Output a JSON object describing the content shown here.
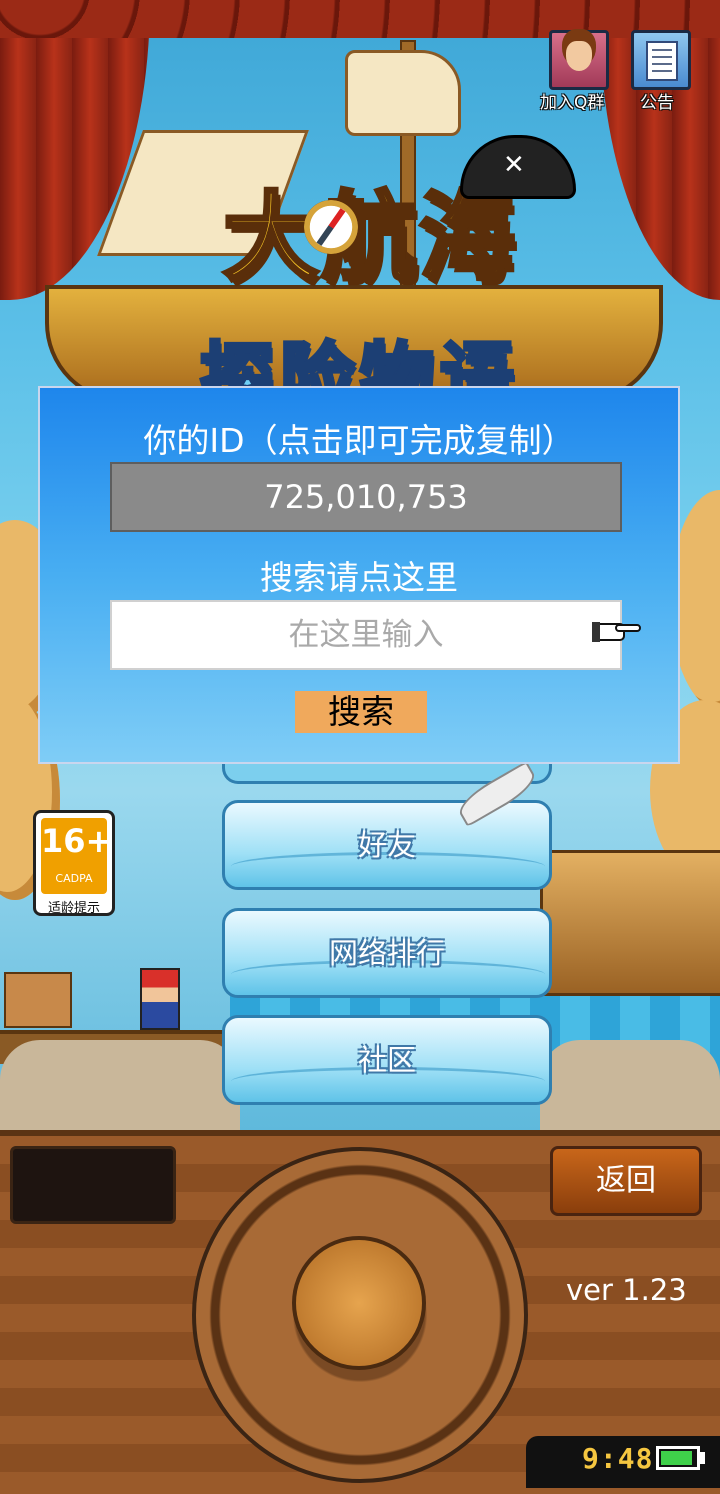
{
  "top_buttons": {
    "join_qq_label": "加入Q群",
    "notice_label": "公告"
  },
  "logo": {
    "title": "大航海",
    "subtitle": "探险物语"
  },
  "dialog": {
    "title": "你的ID（点击即可完成复制）",
    "user_id": "725,010,753",
    "search_label": "搜索请点这里",
    "search_placeholder": "在这里输入",
    "search_button": "搜索"
  },
  "menu": {
    "items": [
      {
        "label": "好友"
      },
      {
        "label": "网络排行"
      },
      {
        "label": "社区"
      }
    ]
  },
  "age_rating": {
    "age": "16+",
    "org": "CADPA",
    "tip": "适龄提示"
  },
  "controls": {
    "back_label": "返回",
    "version": "ver 1.23"
  },
  "status": {
    "time": "9:48",
    "battery_level": 0.9,
    "battery_color": "#3fd04a"
  }
}
